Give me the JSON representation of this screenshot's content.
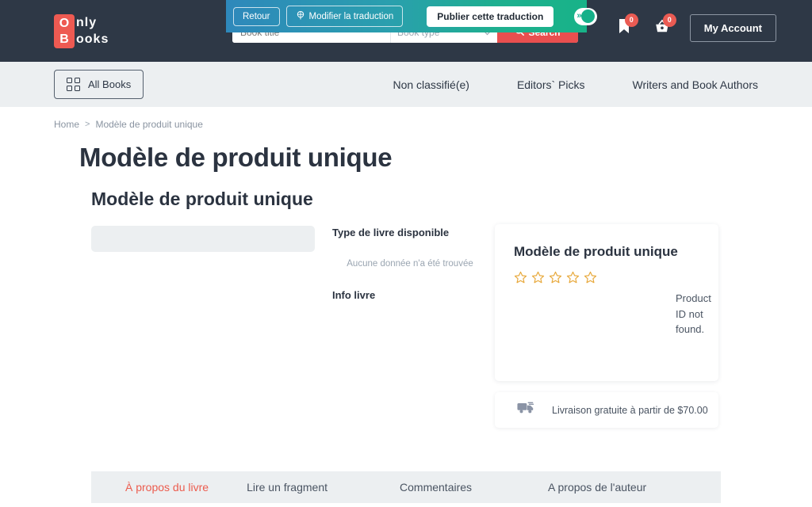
{
  "header": {
    "logo": {
      "block_top": "O",
      "block_bottom": "B",
      "word_top": "nly",
      "word_bottom": "ooks"
    },
    "search": {
      "title_placeholder": "Book title",
      "type_placeholder": "Book type",
      "search_label": "Search"
    },
    "bookmark_count": "0",
    "cart_count": "0",
    "account_label": "My Account",
    "bg_color": "#2e3846"
  },
  "translation_toolbar": {
    "back_label": "Retour",
    "edit_label": "Modifier la traduction",
    "publish_label": "Publier cette traduction",
    "toggle_on": true,
    "gradient_from": "#2e88bb",
    "gradient_to": "#18b388"
  },
  "navbar": {
    "all_books_label": "All Books",
    "links": [
      {
        "label": "Non classifié(e)"
      },
      {
        "label": "Editors` Picks"
      },
      {
        "label": "Writers and Book Authors"
      }
    ],
    "bg_color": "#eceff1"
  },
  "breadcrumb": {
    "home": "Home",
    "separator": ">",
    "current": "Modèle de produit unique"
  },
  "page_title": "Modèle de produit unique",
  "product": {
    "title": "Modèle de produit unique",
    "book_type_label": "Type de livre disponible",
    "no_data_text": "Aucune donnée n'a été trouvée",
    "book_info_label": "Info livre",
    "card_title": "Modèle de produit unique",
    "rating_stars": 5,
    "rating_filled": 0,
    "star_color": "#e8a93c",
    "product_id_error": "Product ID not found.",
    "shipping_text": "Livraison gratuite à partir de $70.00"
  },
  "tabs": [
    {
      "label": "À propos du livre",
      "active": true
    },
    {
      "label": "Lire un fragment",
      "active": false
    },
    {
      "label": "Commentaires",
      "active": false
    },
    {
      "label": "A propos de l'auteur",
      "active": false
    }
  ],
  "accent_color": "#ec5c4e"
}
